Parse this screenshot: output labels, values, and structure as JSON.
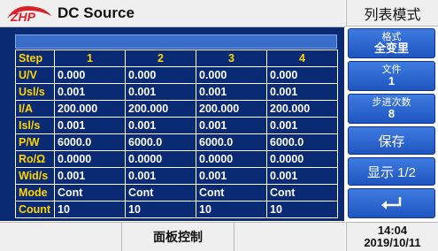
{
  "header": {
    "logo_text": "ZHP",
    "title": "DC Source",
    "mode_label": "列表模式"
  },
  "table": {
    "columns": [
      "Step",
      "1",
      "2",
      "3",
      "4"
    ],
    "rows": [
      {
        "label": "U/V",
        "values": [
          "0.000",
          "0.000",
          "0.000",
          "0.000"
        ]
      },
      {
        "label": "Usl/s",
        "values": [
          "0.001",
          "0.001",
          "0.001",
          "0.001"
        ]
      },
      {
        "label": "I/A",
        "values": [
          "200.000",
          "200.000",
          "200.000",
          "200.000"
        ]
      },
      {
        "label": "Isl/s",
        "values": [
          "0.001",
          "0.001",
          "0.001",
          "0.001"
        ]
      },
      {
        "label": "P/W",
        "values": [
          "6000.0",
          "6000.0",
          "6000.0",
          "6000.0"
        ]
      },
      {
        "label": "Ro/Ω",
        "values": [
          "0.0000",
          "0.0000",
          "0.0000",
          "0.0000"
        ]
      },
      {
        "label": "Wid/s",
        "values": [
          "0.001",
          "0.001",
          "0.001",
          "0.001"
        ]
      },
      {
        "label": "Mode",
        "values": [
          "Cont",
          "Cont",
          "Cont",
          "Cont"
        ]
      },
      {
        "label": "Count",
        "values": [
          "10",
          "10",
          "10",
          "10"
        ]
      }
    ]
  },
  "sidebar": {
    "format": {
      "label": "格式",
      "value": "全变里"
    },
    "file": {
      "label": "文件",
      "value": "1"
    },
    "step_cnt": {
      "label": "步进次数",
      "value": "8"
    },
    "save_label": "保存",
    "display_label": "显示 1/2",
    "enter_icon": "enter-return-icon"
  },
  "footer": {
    "panel_label": "面板控制",
    "time": "14:04",
    "date": "2019/10/11"
  },
  "colors": {
    "table_bg": "#0a2a73",
    "label_yellow": "#ffd400",
    "button_blue": "#2a62cf",
    "logo_red": "#d8222a"
  }
}
